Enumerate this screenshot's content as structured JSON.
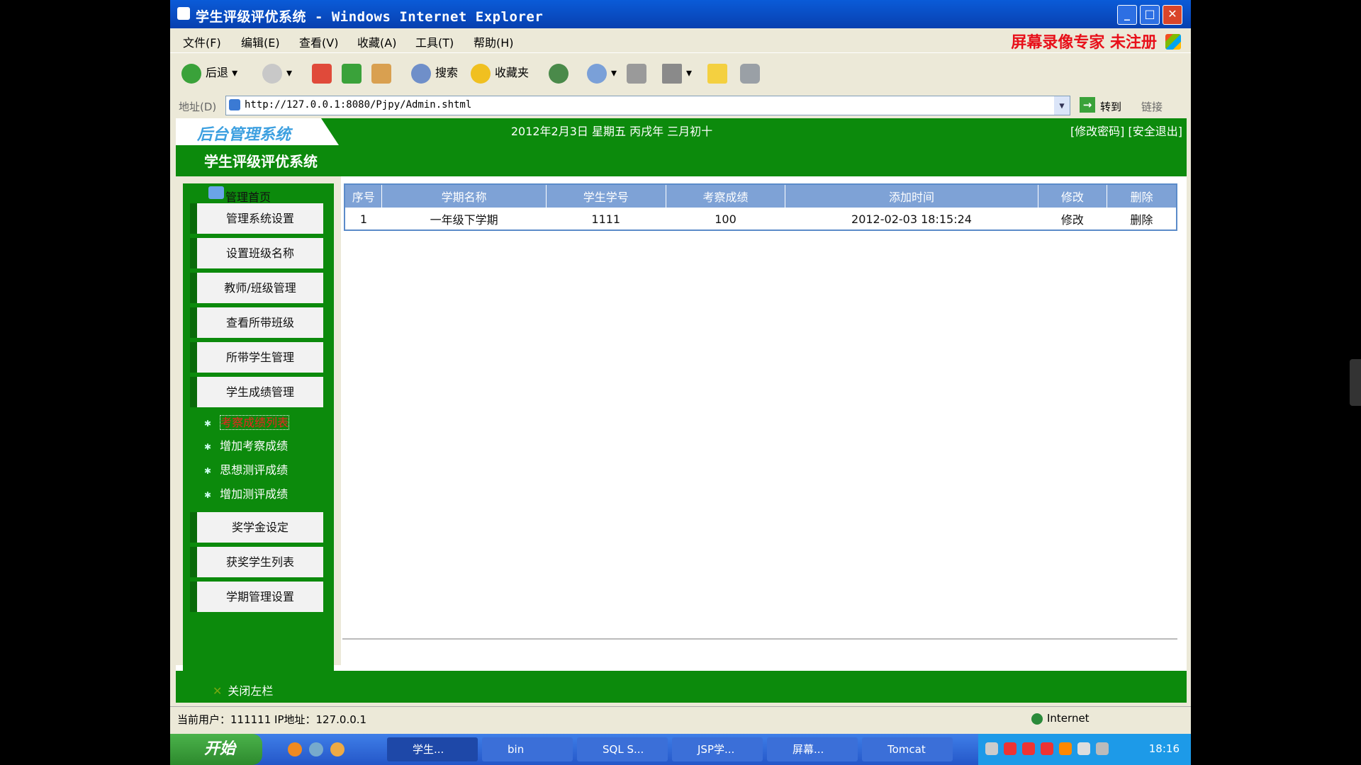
{
  "window": {
    "title": "学生评级评优系统 - Windows Internet Explorer",
    "watermark": "屏幕录像专家 未注册"
  },
  "menu": [
    "文件(F)",
    "编辑(E)",
    "查看(V)",
    "收藏(A)",
    "工具(T)",
    "帮助(H)"
  ],
  "toolbar": {
    "back": "后退",
    "search": "搜索",
    "favorites": "收藏夹"
  },
  "address": {
    "label": "地址(D)",
    "url": "http://127.0.0.1:8080/Pjpy/Admin.shtml",
    "go": "转到",
    "links": "链接"
  },
  "header": {
    "logo": "后台管理系统",
    "date": "2012年2月3日 星期五 丙戌年 三月初十",
    "links": "[修改密码] [安全退出]",
    "system_title": "学生评级评优系统"
  },
  "sidebar": {
    "home": "管理首页",
    "top_buttons": [
      "管理系统设置",
      "设置班级名称",
      "教师/班级管理",
      "查看所带班级",
      "所带学生管理",
      "学生成绩管理"
    ],
    "sub_items": [
      "考察成绩列表",
      "增加考察成绩",
      "思想测评成绩",
      "增加测评成绩"
    ],
    "bottom_buttons": [
      "奖学金设定",
      "获奖学生列表",
      "学期管理设置"
    ],
    "close": "关闭左栏"
  },
  "table": {
    "headers": [
      "序号",
      "学期名称",
      "学生学号",
      "考察成绩",
      "添加时间",
      "修改",
      "删除"
    ],
    "rows": [
      [
        "1",
        "一年级下学期",
        "1111",
        "100",
        "2012-02-03 18:15:24",
        "修改",
        "删除"
      ]
    ]
  },
  "status": {
    "user": "当前用户：111111   IP地址：127.0.0.1",
    "zone": "Internet"
  },
  "taskbar": {
    "start": "开始",
    "tasks": [
      "学生...",
      "bin",
      "SQL S...",
      "JSP学...",
      "屏幕...",
      "Tomcat"
    ],
    "clock": "18:16"
  },
  "colors": {
    "green": "#0c8a0c",
    "table_header": "#7ea2d6",
    "title_blue": "#0a5bd8"
  }
}
